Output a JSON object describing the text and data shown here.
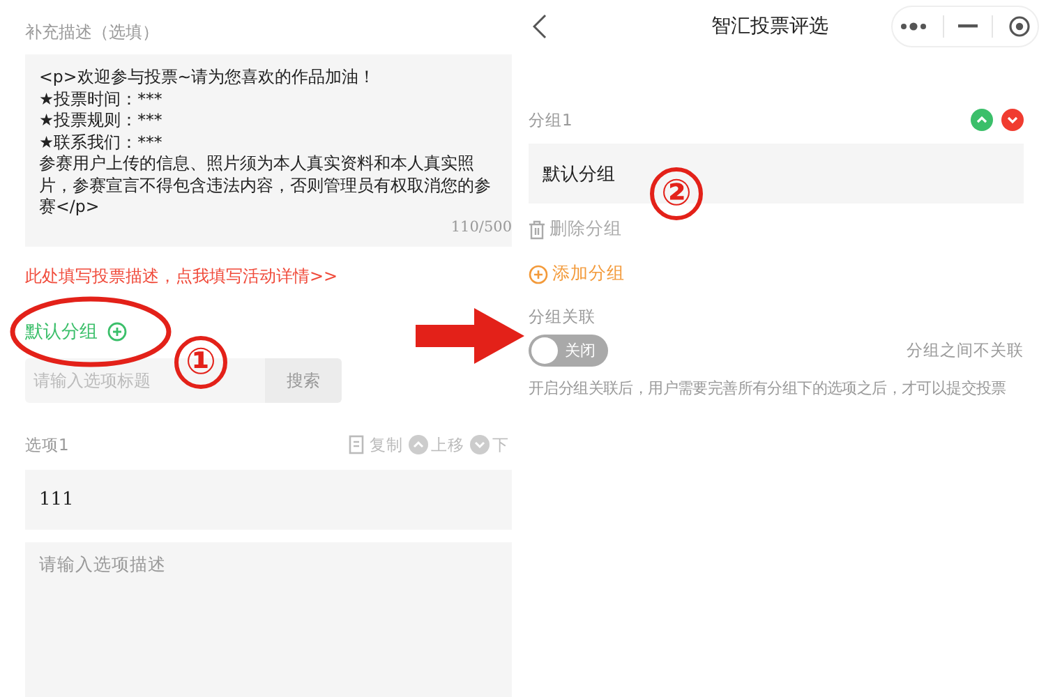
{
  "editor": {
    "description_label": "补充描述（选填）",
    "description_value": "<p>欢迎参与投票~请为您喜欢的作品加油！\n★投票时间：***\n★投票规则：***\n★联系我们：***\n参赛用户上传的信息、照片须为本人真实资料和本人真实照片，参赛宣言不得包含违法内容，否则管理员有权取消您的参赛</p>",
    "counter": "110/500",
    "description_link": "此处填写投票描述，点我填写活动详情>>",
    "group_tab": "默认分组",
    "search": {
      "placeholder": "请输入选项标题",
      "button": "搜索"
    },
    "option": {
      "label": "选项1",
      "actions": [
        {
          "kind": "copy",
          "label": "复制"
        },
        {
          "kind": "up",
          "label": "上移"
        },
        {
          "kind": "down",
          "label": "下"
        }
      ],
      "title_value": "111",
      "description_placeholder": "请输入选项描述"
    }
  },
  "group_settings": {
    "title": "智汇投票评选",
    "group": {
      "label": "分组1",
      "value": "默认分组",
      "delete": "删除分组"
    },
    "add_group": "添加分组",
    "link_label": "分组关联",
    "link_toggle": {
      "on": false,
      "label": "关闭"
    },
    "link_state": "分组之间不关联",
    "link_note": "开启分组关联后，用户需要完善所有分组下的选项之后，才可以提交投票"
  },
  "annotations": [
    {
      "kind": "ellipse"
    },
    {
      "kind": "number",
      "text": "①"
    },
    {
      "kind": "arrow"
    },
    {
      "kind": "number",
      "text": "②"
    }
  ]
}
